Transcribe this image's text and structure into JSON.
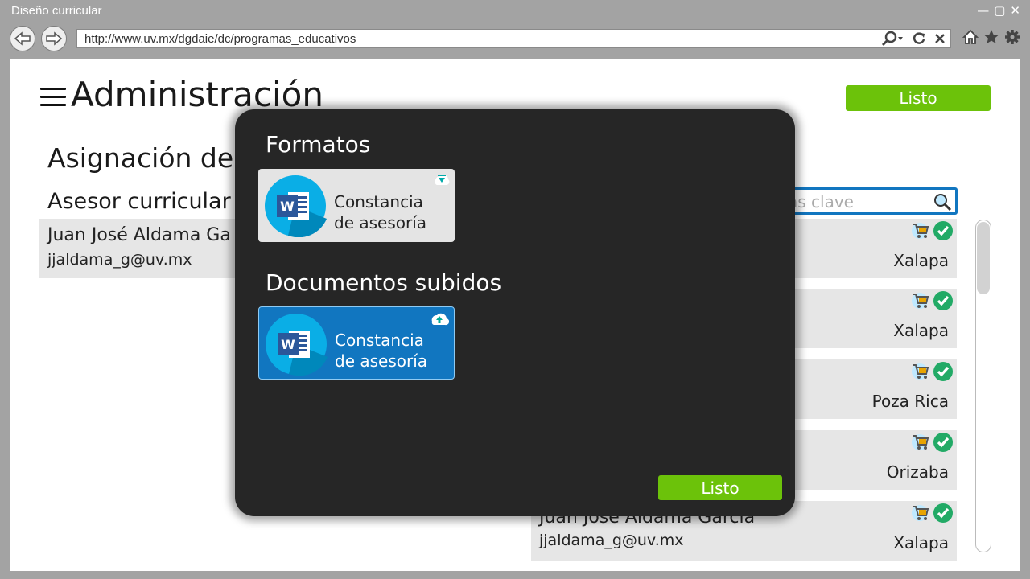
{
  "window": {
    "title": "Diseño curricular"
  },
  "browser": {
    "url": "http://www.uv.mx/dgdaie/dc/programas_educativos"
  },
  "header": {
    "title": "Administración",
    "done_label": "Listo"
  },
  "section": {
    "title": "Asignación de",
    "asesor_label": "Asesor curricular"
  },
  "asesor_card": {
    "name": "Juan José Aldama Ga",
    "email": "jjaldama_g@uv.mx"
  },
  "search": {
    "placeholder": "as clave"
  },
  "list": [
    {
      "name": "",
      "email": "",
      "city": "Xalapa"
    },
    {
      "name": "",
      "email": "",
      "city": "Xalapa"
    },
    {
      "name": "",
      "email": "",
      "city": "Poza Rica"
    },
    {
      "name": "",
      "email": "",
      "city": "Orizaba"
    },
    {
      "name": "Juan José Aldama García",
      "email": "jjaldama_g@uv.mx",
      "city": "Xalapa"
    }
  ],
  "modal": {
    "formats_title": "Formatos",
    "format_doc": {
      "line1": "Constancia",
      "line2": "de asesoría"
    },
    "uploaded_title": "Documentos subidos",
    "uploaded_doc": {
      "line1": "Constancia",
      "line2": "de asesoría"
    },
    "done_label": "Listo"
  },
  "colors": {
    "accent_green": "#6cc20a",
    "accent_blue": "#1176c0",
    "modal_bg": "#262626",
    "word_blue": "#2b579a"
  }
}
